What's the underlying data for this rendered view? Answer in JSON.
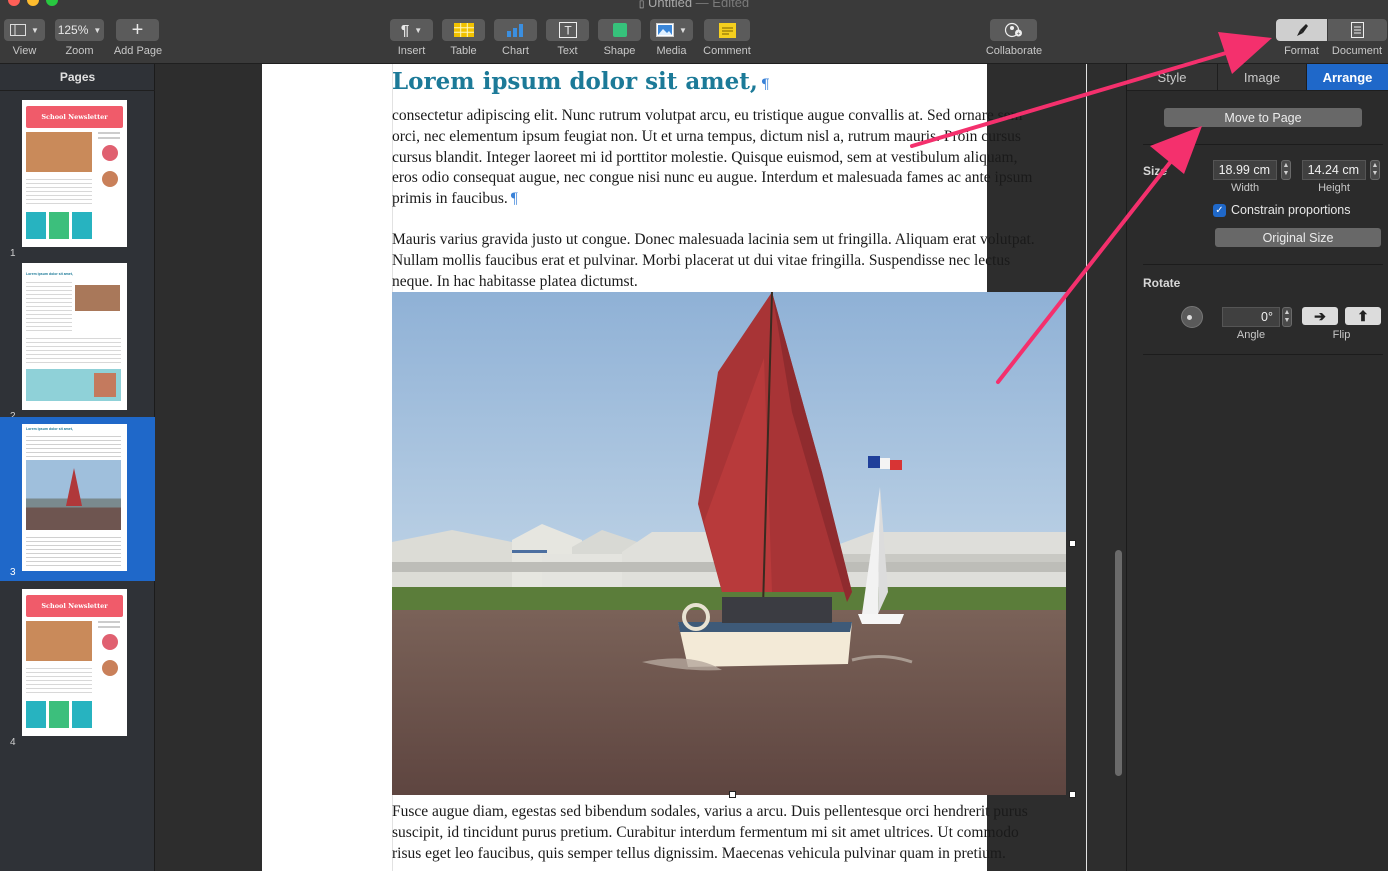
{
  "window": {
    "title": "Untitled",
    "status": "Edited",
    "title_sep": "—"
  },
  "toolbar": {
    "view_label": "View",
    "zoom_value": "125%",
    "zoom_label": "Zoom",
    "add_page_label": "Add Page",
    "insert_label": "Insert",
    "table_label": "Table",
    "chart_label": "Chart",
    "text_label": "Text",
    "shape_label": "Shape",
    "media_label": "Media",
    "comment_label": "Comment",
    "collaborate_label": "Collaborate",
    "format_label": "Format",
    "document_label": "Document"
  },
  "sidebar": {
    "title": "Pages",
    "pages": [
      {
        "number": "1",
        "heading": "School Newsletter"
      },
      {
        "number": "2",
        "heading": "Lorem ipsum dolor sit amet,"
      },
      {
        "number": "3",
        "heading": "Lorem ipsum dolor sit amet,"
      },
      {
        "number": "4",
        "heading": "School Newsletter"
      }
    ]
  },
  "document": {
    "title": "Lorem ipsum dolor sit amet,",
    "para1_lines": [
      "consectetur adipiscing elit. Nunc rutrum volutpat arcu, eu tristique augue convallis at. Sed ornare sem",
      "orci, nec elementum ipsum feugiat non. Ut et urna tempus, dictum nisl a, rutrum mauris. Proin cursus",
      "cursus blandit. Integer laoreet mi id porttitor molestie. Quisque euismod, sem at vestibulum aliquam,",
      "eros odio consequat augue, nec congue nisi nunc eu augue. Interdum et malesuada fames ac ante ipsum",
      "primis in faucibus."
    ],
    "para2_lines": [
      "Mauris varius gravida justo ut congue. Donec malesuada lacinia sem ut fringilla. Aliquam erat volutpat.",
      "Nullam mollis faucibus erat et pulvinar. Morbi placerat ut dui vitae fringilla. Suspendisse nec lectus",
      "neque. In hac habitasse platea dictumst."
    ],
    "para3_lines": [
      "Fusce augue diam, egestas sed bibendum sodales, varius a arcu. Duis pellentesque orci hendrerit purus",
      "suscipit, id tincidunt purus pretium. Curabitur interdum fermentum mi sit amet ultrices. Ut commodo",
      "risus eget leo faucibus, quis semper tellus dignissim. Maecenas vehicula pulvinar quam in pretium."
    ]
  },
  "inspector": {
    "tabs": [
      "Style",
      "Image",
      "Arrange"
    ],
    "active_tab": "Arrange",
    "move_to_page": "Move to Page",
    "size_label": "Size",
    "width_value": "18.99 cm",
    "width_label": "Width",
    "height_value": "14.24 cm",
    "height_label": "Height",
    "constrain_label": "Constrain proportions",
    "constrain_checked": true,
    "original_size": "Original Size",
    "rotate_title": "Rotate",
    "angle_value": "0°",
    "angle_label": "Angle",
    "flip_label": "Flip"
  },
  "colors": {
    "accent": "#1f68c9",
    "annotation_arrow": "#f4306d",
    "title_teal": "#1c7a98"
  }
}
